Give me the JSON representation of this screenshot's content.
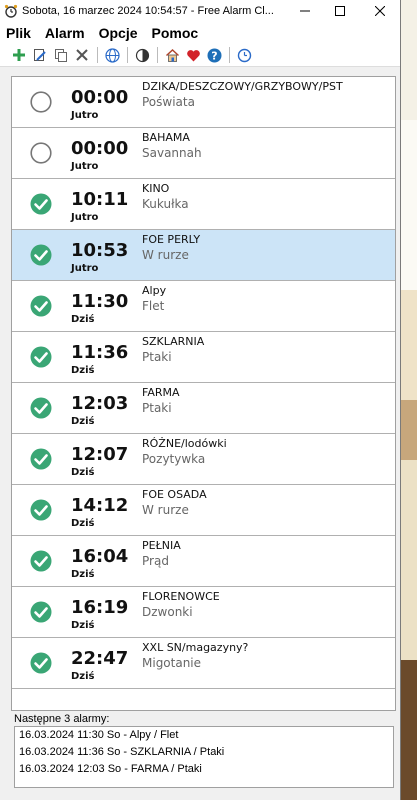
{
  "window": {
    "title": "Sobota, 16 marzec 2024 10:54:57 - Free Alarm Cl..."
  },
  "menu": [
    "Plik",
    "Alarm",
    "Opcje",
    "Pomoc"
  ],
  "toolbar_icons": [
    "add-icon",
    "edit-icon",
    "copy-icon",
    "delete-icon",
    "globe-icon",
    "contrast-icon",
    "home-icon",
    "heart-icon",
    "help-icon",
    "clock-icon"
  ],
  "colors": {
    "enabled": "#3aa675",
    "selected_row": "#cce4f7",
    "heart": "#d2232a",
    "help": "#1e6fb8"
  },
  "alarms": [
    {
      "enabled": false,
      "time": "00:00",
      "day": "Jutro",
      "name": "DZIKA/DESZCZOWY/GRZYBOWY/PST",
      "sound": "Poświata",
      "selected": false
    },
    {
      "enabled": false,
      "time": "00:00",
      "day": "Jutro",
      "name": "BAHAMA",
      "sound": "Savannah",
      "selected": false
    },
    {
      "enabled": true,
      "time": "10:11",
      "day": "Jutro",
      "name": "KINO",
      "sound": "Kukułka",
      "selected": false
    },
    {
      "enabled": true,
      "time": "10:53",
      "day": "Jutro",
      "name": "FOE PERLY",
      "sound": "W rurze",
      "selected": true
    },
    {
      "enabled": true,
      "time": "11:30",
      "day": "Dziś",
      "name": "Alpy",
      "sound": "Flet",
      "selected": false
    },
    {
      "enabled": true,
      "time": "11:36",
      "day": "Dziś",
      "name": "SZKLARNIA",
      "sound": "Ptaki",
      "selected": false
    },
    {
      "enabled": true,
      "time": "12:03",
      "day": "Dziś",
      "name": "FARMA",
      "sound": "Ptaki",
      "selected": false
    },
    {
      "enabled": true,
      "time": "12:07",
      "day": "Dziś",
      "name": "RÓŻNE/lodówki",
      "sound": "Pozytywka",
      "selected": false
    },
    {
      "enabled": true,
      "time": "14:12",
      "day": "Dziś",
      "name": "FOE OSADA",
      "sound": "W rurze",
      "selected": false
    },
    {
      "enabled": true,
      "time": "16:04",
      "day": "Dziś",
      "name": "PEŁNIA",
      "sound": "Prąd",
      "selected": false
    },
    {
      "enabled": true,
      "time": "16:19",
      "day": "Dziś",
      "name": "FLORENOWCE",
      "sound": "Dzwonki",
      "selected": false
    },
    {
      "enabled": true,
      "time": "22:47",
      "day": "Dziś",
      "name": "XXL SN/magazyny?",
      "sound": "Migotanie",
      "selected": false
    }
  ],
  "next_alarms": {
    "label": "Następne 3 alarmy:",
    "items": [
      "16.03.2024 11:30 So - Alpy / Flet",
      "16.03.2024 11:36 So - SZKLARNIA / Ptaki",
      "16.03.2024 12:03 So - FARMA / Ptaki"
    ]
  }
}
